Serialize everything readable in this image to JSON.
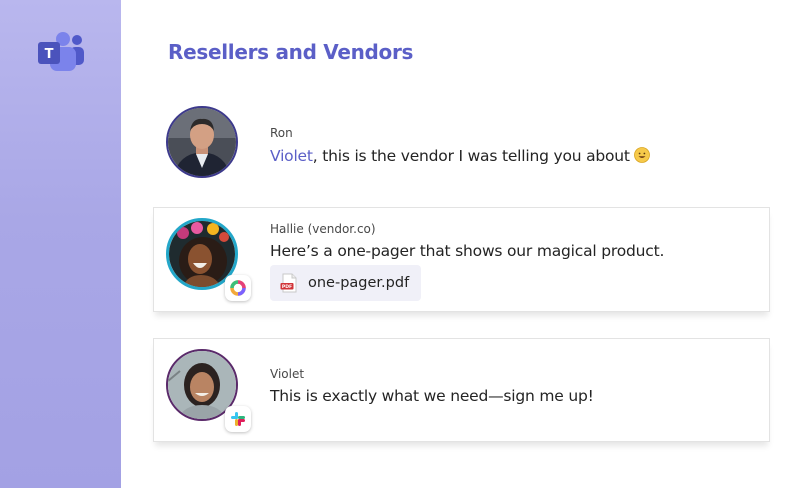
{
  "sidebar": {
    "logo_icon": "microsoft-teams-icon",
    "accent": "#5b5fc7"
  },
  "channel": {
    "title": "Resellers and Vendors"
  },
  "messages": [
    {
      "sender": "Ron",
      "mention": "Violet",
      "text": ", this is the vendor I was telling you about",
      "emoji": "smiling-face-emoji",
      "avatar_border": "#3d3a8c"
    },
    {
      "sender": "Hallie (vendor.co)",
      "text": "Here’s a one-pager that shows our magical product.",
      "app_badge": "vendor-ring-logo-icon",
      "avatar_border": "#23a7c9",
      "attachment": {
        "icon": "pdf-file-icon",
        "icon_label": "PDF",
        "name": "one-pager.pdf"
      }
    },
    {
      "sender": "Violet",
      "text": "This is exactly what we need—sign me up!",
      "app_badge": "slack-logo-icon",
      "avatar_border": "#5a2a6a"
    }
  ]
}
